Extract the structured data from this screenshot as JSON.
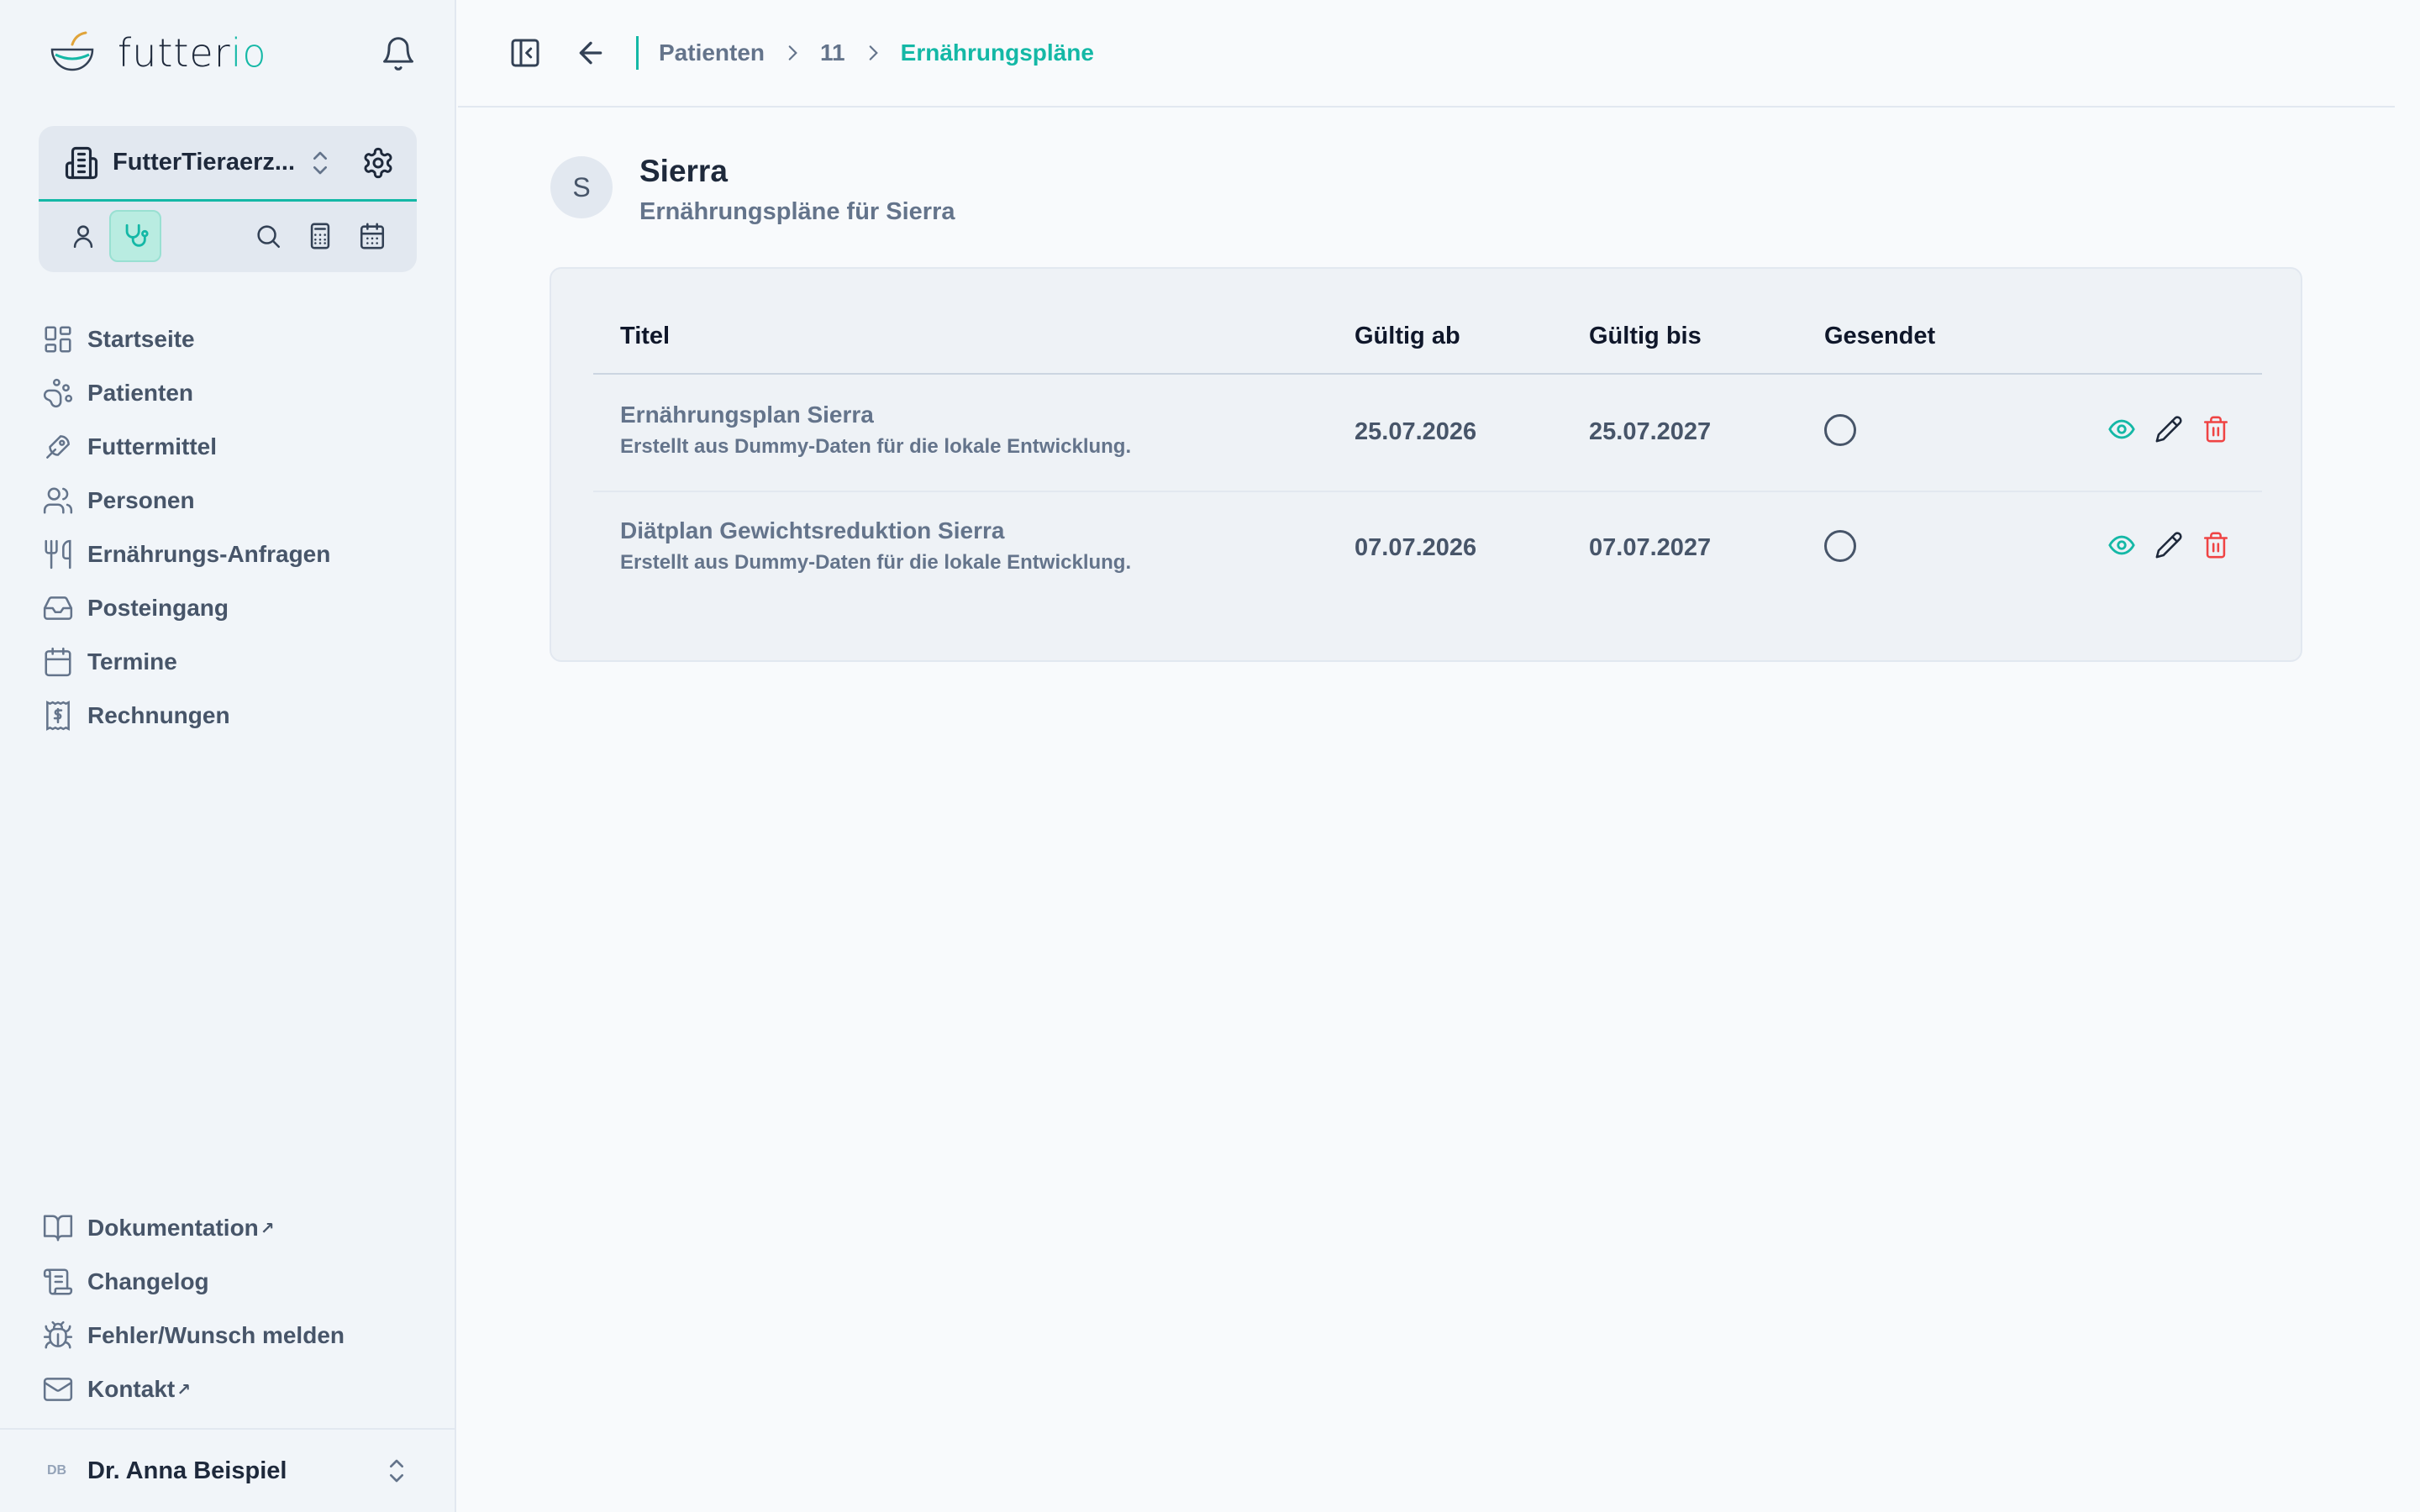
{
  "brand": {
    "name_main": "futter",
    "name_accent": "io"
  },
  "organization": {
    "name": "FutterTieraerz..."
  },
  "nav": {
    "items": [
      {
        "label": "Startseite"
      },
      {
        "label": "Patienten"
      },
      {
        "label": "Futtermittel"
      },
      {
        "label": "Personen"
      },
      {
        "label": "Ernährungs-Anfragen"
      },
      {
        "label": "Posteingang"
      },
      {
        "label": "Termine"
      },
      {
        "label": "Rechnungen"
      }
    ],
    "bottom": [
      {
        "label": "Dokumentation",
        "external_mark": "↗"
      },
      {
        "label": "Changelog"
      },
      {
        "label": "Fehler/Wunsch melden"
      },
      {
        "label": "Kontakt",
        "external_mark": "↗"
      }
    ]
  },
  "user": {
    "initials": "DB",
    "name": "Dr. Anna Beispiel"
  },
  "breadcrumb": {
    "items": [
      "Patienten",
      "11",
      "Ernährungspläne"
    ]
  },
  "patient": {
    "initial": "S",
    "name": "Sierra",
    "subtitle": "Ernährungspläne für Sierra"
  },
  "table": {
    "headers": {
      "title": "Titel",
      "valid_from": "Gültig ab",
      "valid_to": "Gültig bis",
      "sent": "Gesendet"
    },
    "rows": [
      {
        "title": "Ernährungsplan Sierra",
        "description": "Erstellt aus Dummy-Daten für die lokale Entwicklung.",
        "valid_from": "25.07.2026",
        "valid_to": "25.07.2027",
        "sent": false
      },
      {
        "title": "Diätplan Gewichtsreduktion Sierra",
        "description": "Erstellt aus Dummy-Daten für die lokale Entwicklung.",
        "valid_from": "07.07.2026",
        "valid_to": "07.07.2027",
        "sent": false
      }
    ]
  },
  "colors": {
    "accent": "#14b8a6",
    "danger": "#ef4444",
    "text": "#334155",
    "sidebar_bg": "#f1f5f9"
  }
}
